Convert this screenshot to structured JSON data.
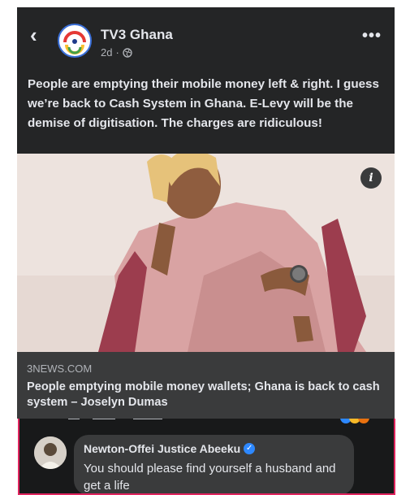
{
  "post": {
    "page_name": "TV3 Ghana",
    "time": "2d",
    "time_separator": "·",
    "text": "People are emptying their mobile money left & right. I guess we’re back to Cash System in Ghana. E-Levy will be the demise of digitisation. The charges are ridiculous!",
    "more_label": "•••",
    "back_label": "‹",
    "info_label": "i"
  },
  "link": {
    "source": "3NEWS.COM",
    "title": "People emptying mobile money wallets; Ghana is back to cash system – Joselyn Dumas"
  },
  "comment": {
    "commenter_name": "Newton-Offei Justice Abeeku",
    "verified_mark": "✓",
    "text": "You should please find yourself a husband and get a life"
  },
  "colors": {
    "card_background": "#242526",
    "link_box": "#3a3b3c",
    "highlight_border": "#e0245e",
    "verified_badge": "#2d88ff"
  }
}
